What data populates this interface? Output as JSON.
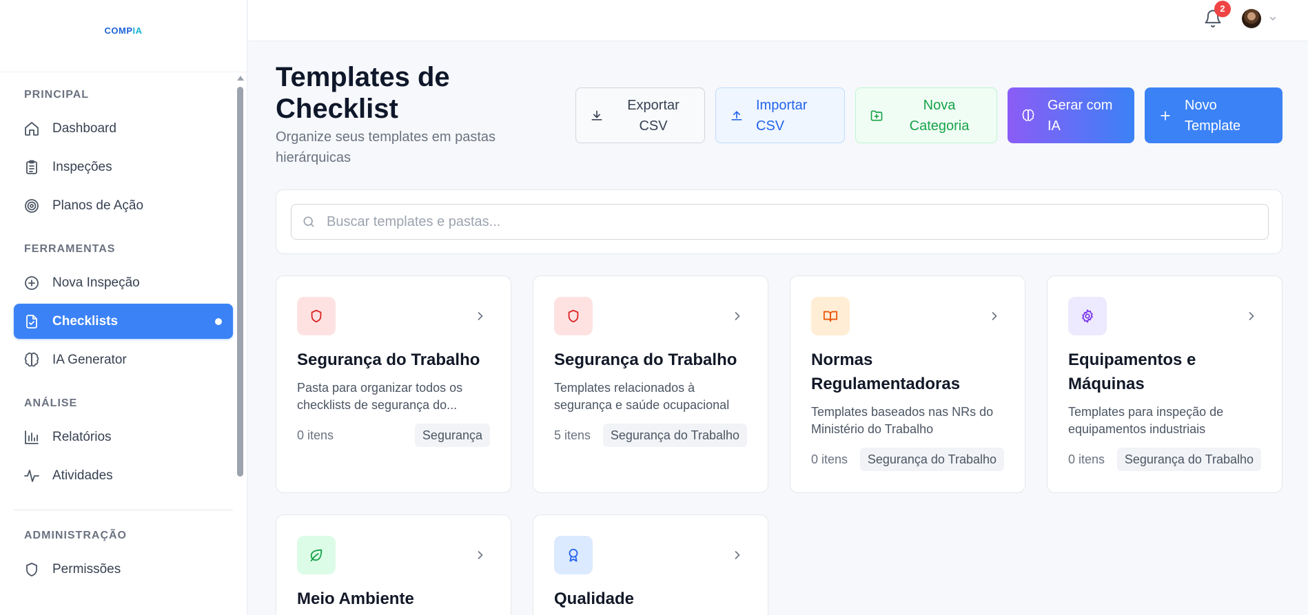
{
  "app": {
    "logo_main": "COMP",
    "logo_accent": "IA"
  },
  "sidebar": {
    "sections": [
      {
        "title": "PRINCIPAL",
        "items": [
          {
            "label": "Dashboard",
            "icon": "home-icon"
          },
          {
            "label": "Inspeções",
            "icon": "clipboard-list-icon"
          },
          {
            "label": "Planos de Ação",
            "icon": "target-icon"
          }
        ]
      },
      {
        "title": "FERRAMENTAS",
        "items": [
          {
            "label": "Nova Inspeção",
            "icon": "plus-circle-icon"
          },
          {
            "label": "Checklists",
            "icon": "file-check-icon",
            "active": true
          },
          {
            "label": "IA Generator",
            "icon": "brain-icon"
          }
        ]
      },
      {
        "title": "ANÁLISE",
        "items": [
          {
            "label": "Relatórios",
            "icon": "bar-chart-icon"
          },
          {
            "label": "Atividades",
            "icon": "activity-icon"
          }
        ]
      },
      {
        "title": "ADMINISTRAÇÃO",
        "items": [
          {
            "label": "Permissões",
            "icon": "shield-icon"
          }
        ]
      }
    ]
  },
  "topbar": {
    "notification_count": "2"
  },
  "header": {
    "title": "Templates de Checklist",
    "subtitle": "Organize seus templates em pastas hierárquicas"
  },
  "actions": {
    "export": "Exportar CSV",
    "import": "Importar CSV",
    "new_category": "Nova Categoria",
    "generate_ai": "Gerar com IA",
    "new_template": "Novo Template"
  },
  "search": {
    "placeholder": "Buscar templates e pastas...",
    "value": ""
  },
  "cards": [
    {
      "title": "Segurança do Trabalho",
      "description": "Pasta para organizar todos os checklists de segurança do...",
      "count": "0 itens",
      "tag": "Segurança",
      "icon": "shield-icon",
      "color": "#dc2626"
    },
    {
      "title": "Segurança do Trabalho",
      "description": "Templates relacionados à segurança e saúde ocupacional",
      "count": "5 itens",
      "tag": "Segurança do Trabalho",
      "icon": "shield-icon",
      "color": "#dc2626"
    },
    {
      "title": "Normas Regulamentadoras",
      "description": "Templates baseados nas NRs do Ministério do Trabalho",
      "count": "0 itens",
      "tag": "Segurança do Trabalho",
      "icon": "book-open-icon",
      "color": "#ea580c"
    },
    {
      "title": "Equipamentos e Máquinas",
      "description": "Templates para inspeção de equipamentos industriais",
      "count": "0 itens",
      "tag": "Segurança do Trabalho",
      "icon": "gear-icon",
      "color": "#7c3aed"
    },
    {
      "title": "Meio Ambiente",
      "icon": "leaf-icon",
      "color": "#16a34a"
    },
    {
      "title": "Qualidade",
      "icon": "award-icon",
      "color": "#2563eb"
    }
  ]
}
